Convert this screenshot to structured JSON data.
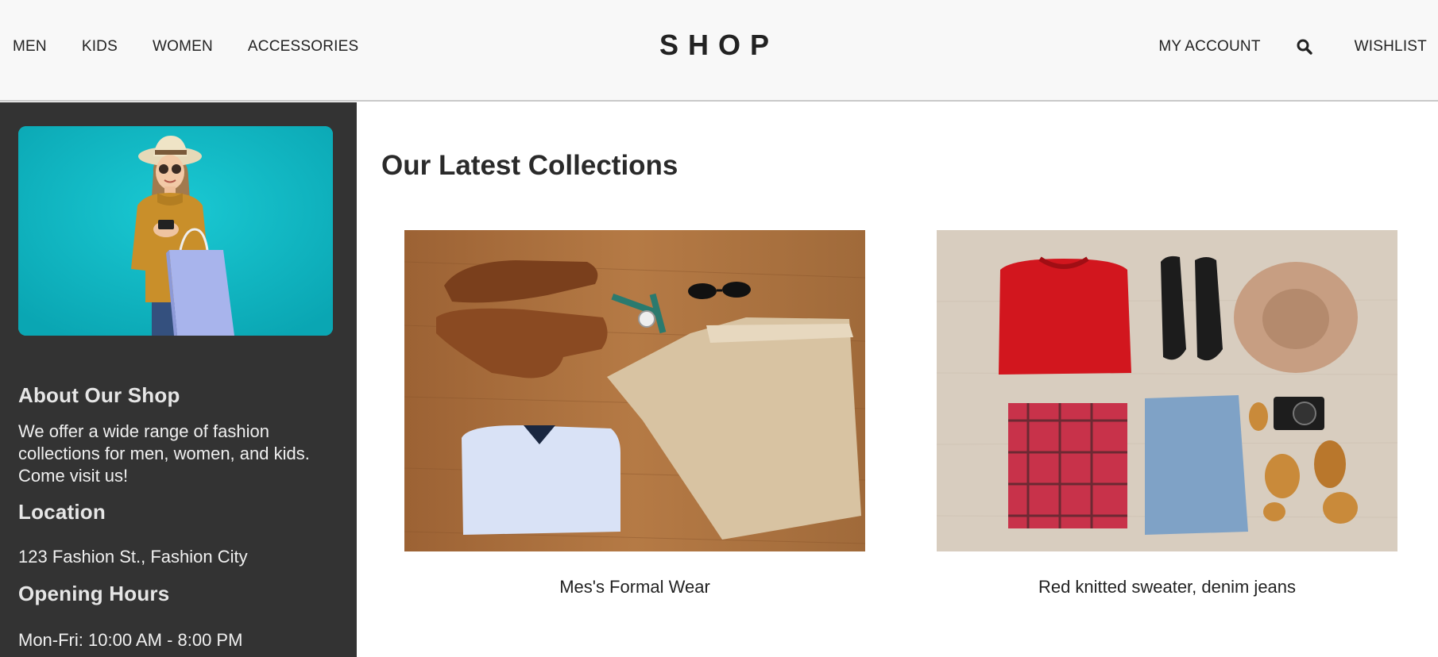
{
  "header": {
    "nav_left": [
      "MEN",
      "KIDS",
      "WOMEN",
      "ACCESSORIES"
    ],
    "brand": "SHOP",
    "my_account": "MY ACCOUNT",
    "wishlist": "WISHLIST",
    "search_icon": "search-icon"
  },
  "sidebar": {
    "about_title": "About Our Shop",
    "about_text": "We offer a wide range of fashion collections for men, women, and kids. Come visit us!",
    "location_title": "Location",
    "location_text": "123 Fashion St., Fashion City",
    "hours_title": "Opening Hours",
    "hours_text": "Mon-Fri: 10:00 AM - 8:00 PM"
  },
  "main": {
    "title": "Our Latest Collections",
    "cards": [
      {
        "caption": "Mes's Formal Wear"
      },
      {
        "caption": "Red knitted sweater, denim jeans"
      }
    ]
  },
  "colors": {
    "header_bg": "#f8f8f8",
    "sidebar_bg": "#333333",
    "hero_bg": "#12bcc6"
  }
}
